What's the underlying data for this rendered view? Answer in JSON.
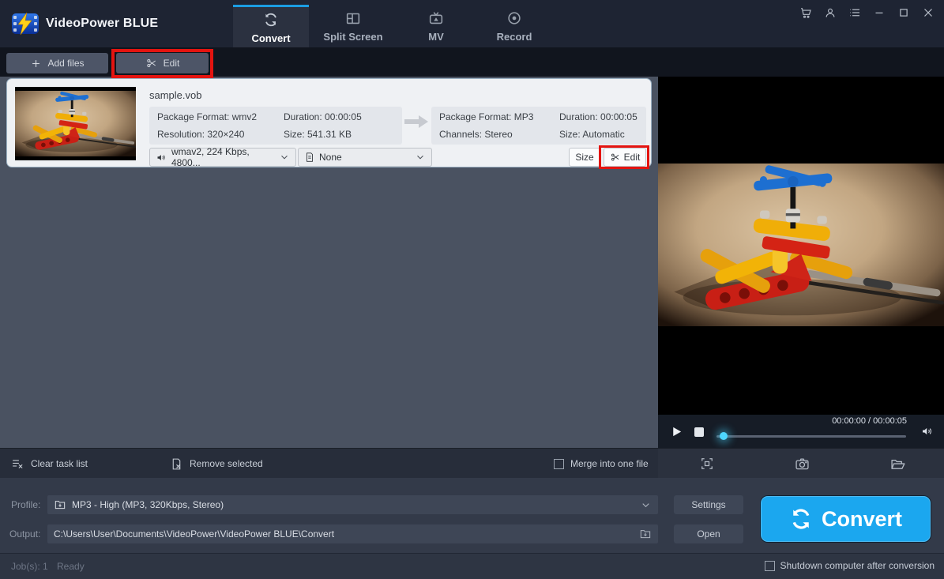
{
  "app": {
    "title": "VideoPower BLUE"
  },
  "header": {
    "tabs": [
      {
        "label": "Convert",
        "active": true
      },
      {
        "label": "Split Screen",
        "active": false
      },
      {
        "label": "MV",
        "active": false
      },
      {
        "label": "Record",
        "active": false
      }
    ]
  },
  "toolbar": {
    "add_files_label": "Add files",
    "edit_label": "Edit"
  },
  "file_item": {
    "name": "sample.vob",
    "source_info": [
      "Package Format: wmv2",
      "Duration: 00:00:05",
      "Resolution: 320×240",
      "Size: 541.31 KB"
    ],
    "target_info": [
      "Package Format: MP3",
      "Duration: 00:00:05",
      "Channels: Stereo",
      "Size: Automatic"
    ],
    "audio_track": "wmav2, 224 Kbps, 4800...",
    "subtitle": "None",
    "size_button_label": "Size",
    "edit_button_label": "Edit"
  },
  "player": {
    "time": "00:00:00 / 00:00:05"
  },
  "task_bar": {
    "clear_label": "Clear task list",
    "remove_label": "Remove selected",
    "merge_label": "Merge into one file",
    "merge_checked": false
  },
  "output_panel": {
    "profile_label": "Profile:",
    "profile_value": "MP3 - High (MP3, 320Kbps, Stereo)",
    "output_label": "Output:",
    "output_value": "C:\\Users\\User\\Documents\\VideoPower\\VideoPower BLUE\\Convert",
    "settings_label": "Settings",
    "open_label": "Open",
    "convert_label": "Convert"
  },
  "status_bar": {
    "jobs": "Job(s): 1",
    "state": "Ready",
    "shutdown_label": "Shutdown computer after conversion",
    "shutdown_checked": false
  },
  "icons": [
    "cart-icon",
    "user-icon",
    "menu-icon",
    "minimize-icon",
    "maximize-icon",
    "close-icon",
    "convert-tab-icon",
    "split-screen-icon",
    "mv-tv-icon",
    "record-icon",
    "plus-icon",
    "scissors-icon",
    "speaker-icon",
    "subtitle-doc-icon",
    "chevron-down-icon",
    "flow-arrow-icon",
    "clear-list-icon",
    "remove-doc-icon",
    "play-icon",
    "stop-icon",
    "volume-icon",
    "fullscreen-icon",
    "camera-icon",
    "folder-open-icon",
    "profile-folder-icon",
    "output-folder-icon",
    "refresh-icon"
  ],
  "colors": {
    "accent_blue": "#1b9de2",
    "convert_button": "#1ba7ef",
    "annotation_red": "#e41410"
  }
}
